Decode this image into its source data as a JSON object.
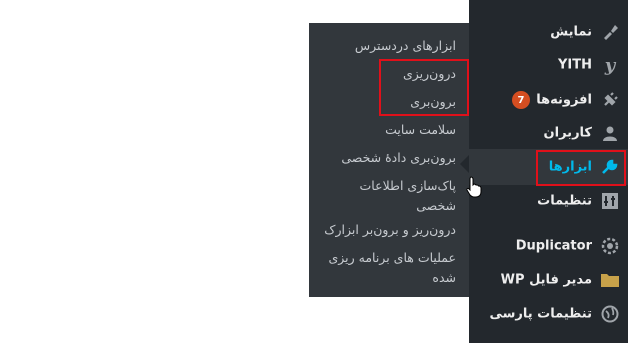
{
  "sidebar": {
    "items": [
      {
        "label": "نمایش",
        "icon": "paint-brush-icon"
      },
      {
        "label": "YITH",
        "icon": "yith-logo-icon"
      },
      {
        "label": "افزونه‌ها",
        "icon": "plugin-icon",
        "badge": "7"
      },
      {
        "label": "کاربران",
        "icon": "user-icon"
      },
      {
        "label": "ابزارها",
        "icon": "wrench-icon",
        "active": true
      },
      {
        "label": "تنظیمات",
        "icon": "settings-sliders-icon"
      },
      {
        "label": "Duplicator",
        "icon": "duplicator-gear-icon"
      },
      {
        "label": "WP مدیر فایل",
        "icon": "folder-icon"
      },
      {
        "label": "تنظیمات پارسی",
        "icon": "globe-icon"
      }
    ]
  },
  "submenu": {
    "items": [
      {
        "label": "ابزارهای دردسترس"
      },
      {
        "label": "درون‌ریزی"
      },
      {
        "label": "برون‌بری"
      },
      {
        "label": "سلامت سایت"
      },
      {
        "label": "برون‌بری دادهٔ شخصی"
      },
      {
        "label": "پاک‌سازی اطلاعات شخصی"
      },
      {
        "label": "درون‌ریز و برون‌بر ابزارک"
      },
      {
        "label": "عملیات های برنامه ریزی شده"
      }
    ]
  },
  "colors": {
    "sidebar_bg": "#23282d",
    "submenu_bg": "#32373c",
    "active_text": "#00b9eb",
    "highlight_border": "#e0101a",
    "badge_bg": "#d54e21"
  }
}
